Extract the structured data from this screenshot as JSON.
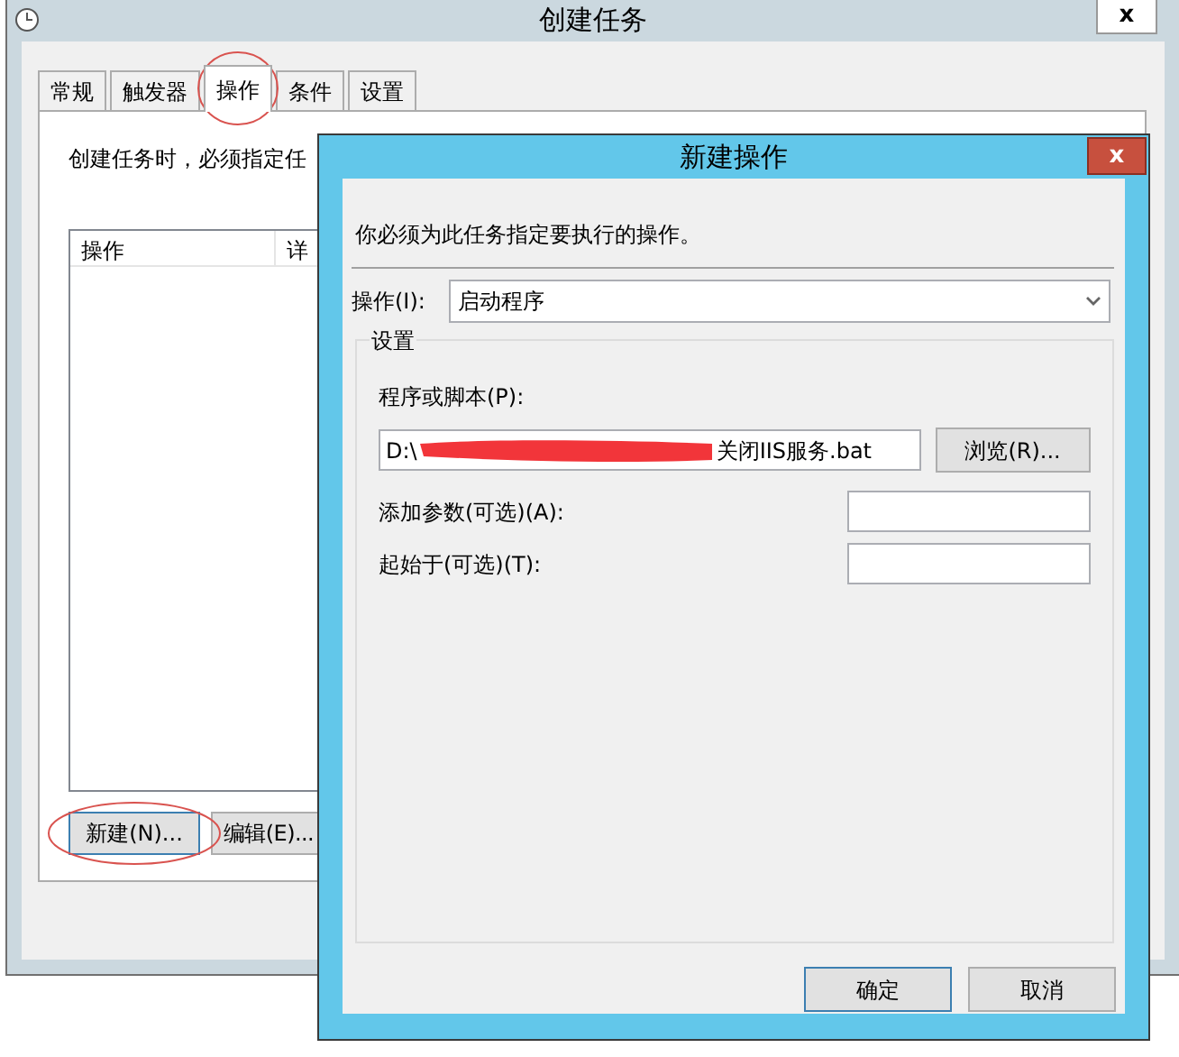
{
  "main_window": {
    "title": "创建任务",
    "close_label": "x",
    "tabs": [
      {
        "label": "常规",
        "selected": false,
        "circled": false
      },
      {
        "label": "触发器",
        "selected": false,
        "circled": false
      },
      {
        "label": "操作",
        "selected": true,
        "circled": true
      },
      {
        "label": "条件",
        "selected": false,
        "circled": false
      },
      {
        "label": "设置",
        "selected": false,
        "circled": false
      }
    ],
    "instruction": "创建任务时，必须指定任",
    "table": {
      "columns": [
        "操作",
        "详"
      ]
    },
    "buttons": [
      {
        "label": "新建(N)...",
        "focused": true,
        "circled": true
      },
      {
        "label": "编辑(E)...",
        "focused": false,
        "circled": false
      }
    ]
  },
  "dialog": {
    "title": "新建操作",
    "close_label": "x",
    "instruction": "你必须为此任务指定要执行的操作。",
    "action": {
      "label": "操作(I):",
      "value": "启动程序"
    },
    "settings": {
      "title": "设置",
      "program": {
        "label": "程序或脚本(P):",
        "value_start": "D:\\",
        "value_end": "关闭IIS服务.bat",
        "redacted": true
      },
      "browse_button": "浏览(R)...",
      "arguments": {
        "label": "添加参数(可选)(A):"
      },
      "start_in": {
        "label": "起始于(可选)(T):"
      }
    },
    "buttons": [
      {
        "label": "确定",
        "focused": true
      },
      {
        "label": "取消",
        "focused": false
      }
    ]
  }
}
